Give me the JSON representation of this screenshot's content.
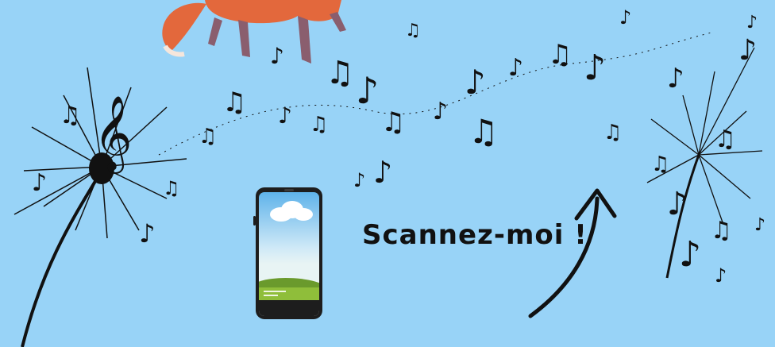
{
  "caption": {
    "text": "Scannez-moi !"
  },
  "colors": {
    "background": "#98d3f7",
    "ink": "#111111",
    "fox_orange": "#e3683c",
    "fox_leg": "#8a5e6e",
    "phone_body": "#1d1d1d",
    "hill_green": "#6a9a2c"
  },
  "icons": {
    "phone": "smartphone-icon",
    "arrow": "curved-arrow-icon",
    "treble": "treble-clef-icon"
  }
}
